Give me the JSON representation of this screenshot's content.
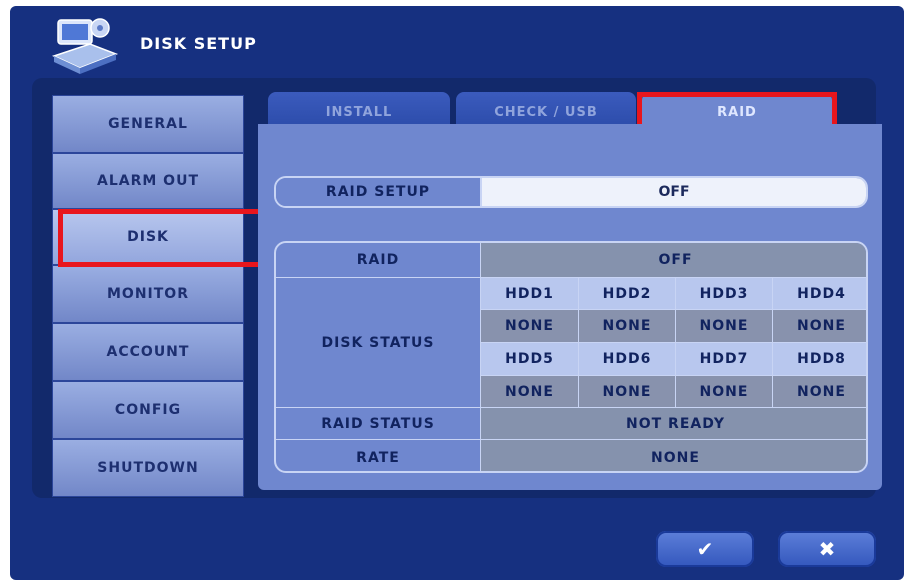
{
  "window": {
    "title": "DISK SETUP"
  },
  "sidebar": {
    "items": [
      {
        "label": "GENERAL"
      },
      {
        "label": "ALARM OUT"
      },
      {
        "label": "DISK",
        "active": true
      },
      {
        "label": "MONITOR"
      },
      {
        "label": "ACCOUNT"
      },
      {
        "label": "CONFIG"
      },
      {
        "label": "SHUTDOWN"
      }
    ]
  },
  "tabs": [
    {
      "label": "INSTALL"
    },
    {
      "label": "CHECK / USB"
    },
    {
      "label": "RAID",
      "active": true
    }
  ],
  "raid_setup": {
    "label": "RAID SETUP",
    "value": "OFF"
  },
  "raid_table": {
    "raid_label": "RAID",
    "raid_value": "OFF",
    "disk_status_label": "DISK STATUS",
    "disks_row1": [
      "HDD1",
      "HDD2",
      "HDD3",
      "HDD4"
    ],
    "status_row1": [
      "NONE",
      "NONE",
      "NONE",
      "NONE"
    ],
    "disks_row2": [
      "HDD5",
      "HDD6",
      "HDD7",
      "HDD8"
    ],
    "status_row2": [
      "NONE",
      "NONE",
      "NONE",
      "NONE"
    ],
    "raid_status_label": "RAID STATUS",
    "raid_status_value": "NOT READY",
    "rate_label": "RATE",
    "rate_value": "NONE"
  },
  "buttons": {
    "ok_icon": "✔",
    "cancel_icon": "✖"
  },
  "colors": {
    "highlight": "#e8161d",
    "background": "#163080"
  }
}
